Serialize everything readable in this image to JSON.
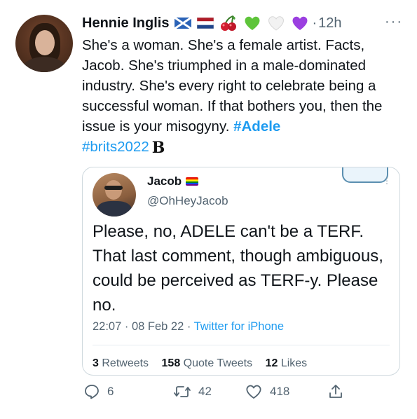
{
  "tweet": {
    "author_name": "Hennie Inglis",
    "separator": "·",
    "time": "12h",
    "more_label": "···",
    "body": {
      "line_text": "She's a woman. She's a female artist. Facts, Jacob. She's triumphed in a male-dominated industry. She's every right to celebrate being a successful woman. If that bothers you, then the issue is your misogyny. ",
      "hashtag_1": "#Adele",
      "hashtag_2": "#brits2022",
      "trailing_logo": "B"
    },
    "emojis": [
      "scotland-flag-icon",
      "netherlands-flag-icon",
      "cherries-icon",
      "green-heart-icon",
      "white-heart-icon",
      "purple-heart-icon"
    ]
  },
  "quote": {
    "author_name": "Jacob",
    "handle": "@OhHeyJacob",
    "text": "Please, no, ADELE can't be a TERF. That last comment, though ambiguous, could be perceived as TERF-y. Please no.",
    "timestamp": "22:07 · 08 Feb 22 · ",
    "source": "Twitter for iPhone",
    "stats": {
      "retweets_count": "3",
      "retweets_label": "Retweets",
      "quotes_count": "158",
      "quotes_label": "Quote Tweets",
      "likes_count": "12",
      "likes_label": "Likes"
    }
  },
  "actions": {
    "replies": "6",
    "retweets": "42",
    "likes": "418"
  },
  "colors": {
    "link": "#1d9bf0",
    "secondary_text": "#536471",
    "border": "#cfd9de"
  }
}
